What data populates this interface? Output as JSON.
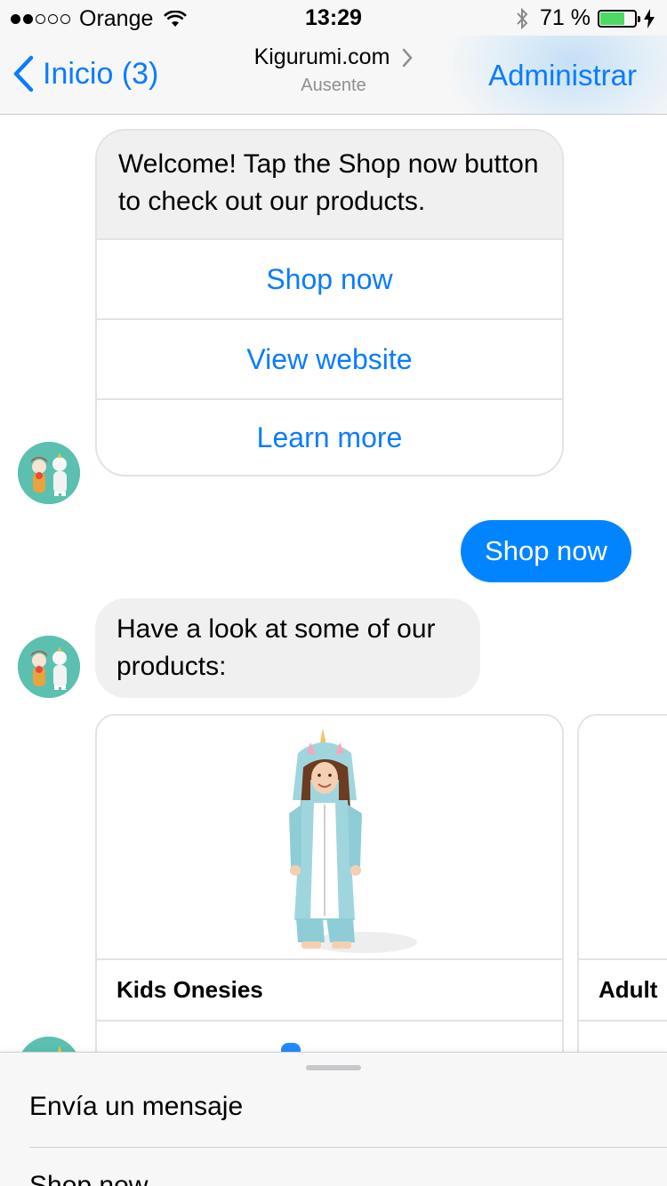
{
  "status_bar": {
    "carrier": "Orange",
    "time": "13:29",
    "battery_percent": "71 %",
    "battery_level": 0.71,
    "signal_bars_filled": 2,
    "signal_bars_total": 5
  },
  "nav": {
    "back_label": "Inicio (3)",
    "title": "Kigurumi.com",
    "subtitle": "Ausente",
    "action_label": "Administrar"
  },
  "messages": {
    "welcome_text": "Welcome! Tap the Shop now button to check out our products.",
    "quick_replies": [
      "Shop now",
      "View website",
      "Learn more"
    ],
    "outgoing_text": "Shop now",
    "products_intro": "Have a look at some of our products:"
  },
  "carousel": {
    "cards": [
      {
        "title": "Kids Onesies"
      },
      {
        "title": "Adult"
      }
    ]
  },
  "composer": {
    "placeholder": "Envía un mensaje",
    "menu_item": "Shop now"
  },
  "colors": {
    "accent": "#0a7cff",
    "outgoing_bubble": "#0084ff",
    "incoming_bubble": "#f0f0f0",
    "battery": "#4cd964",
    "avatar_bg": "#5cc0b0"
  }
}
